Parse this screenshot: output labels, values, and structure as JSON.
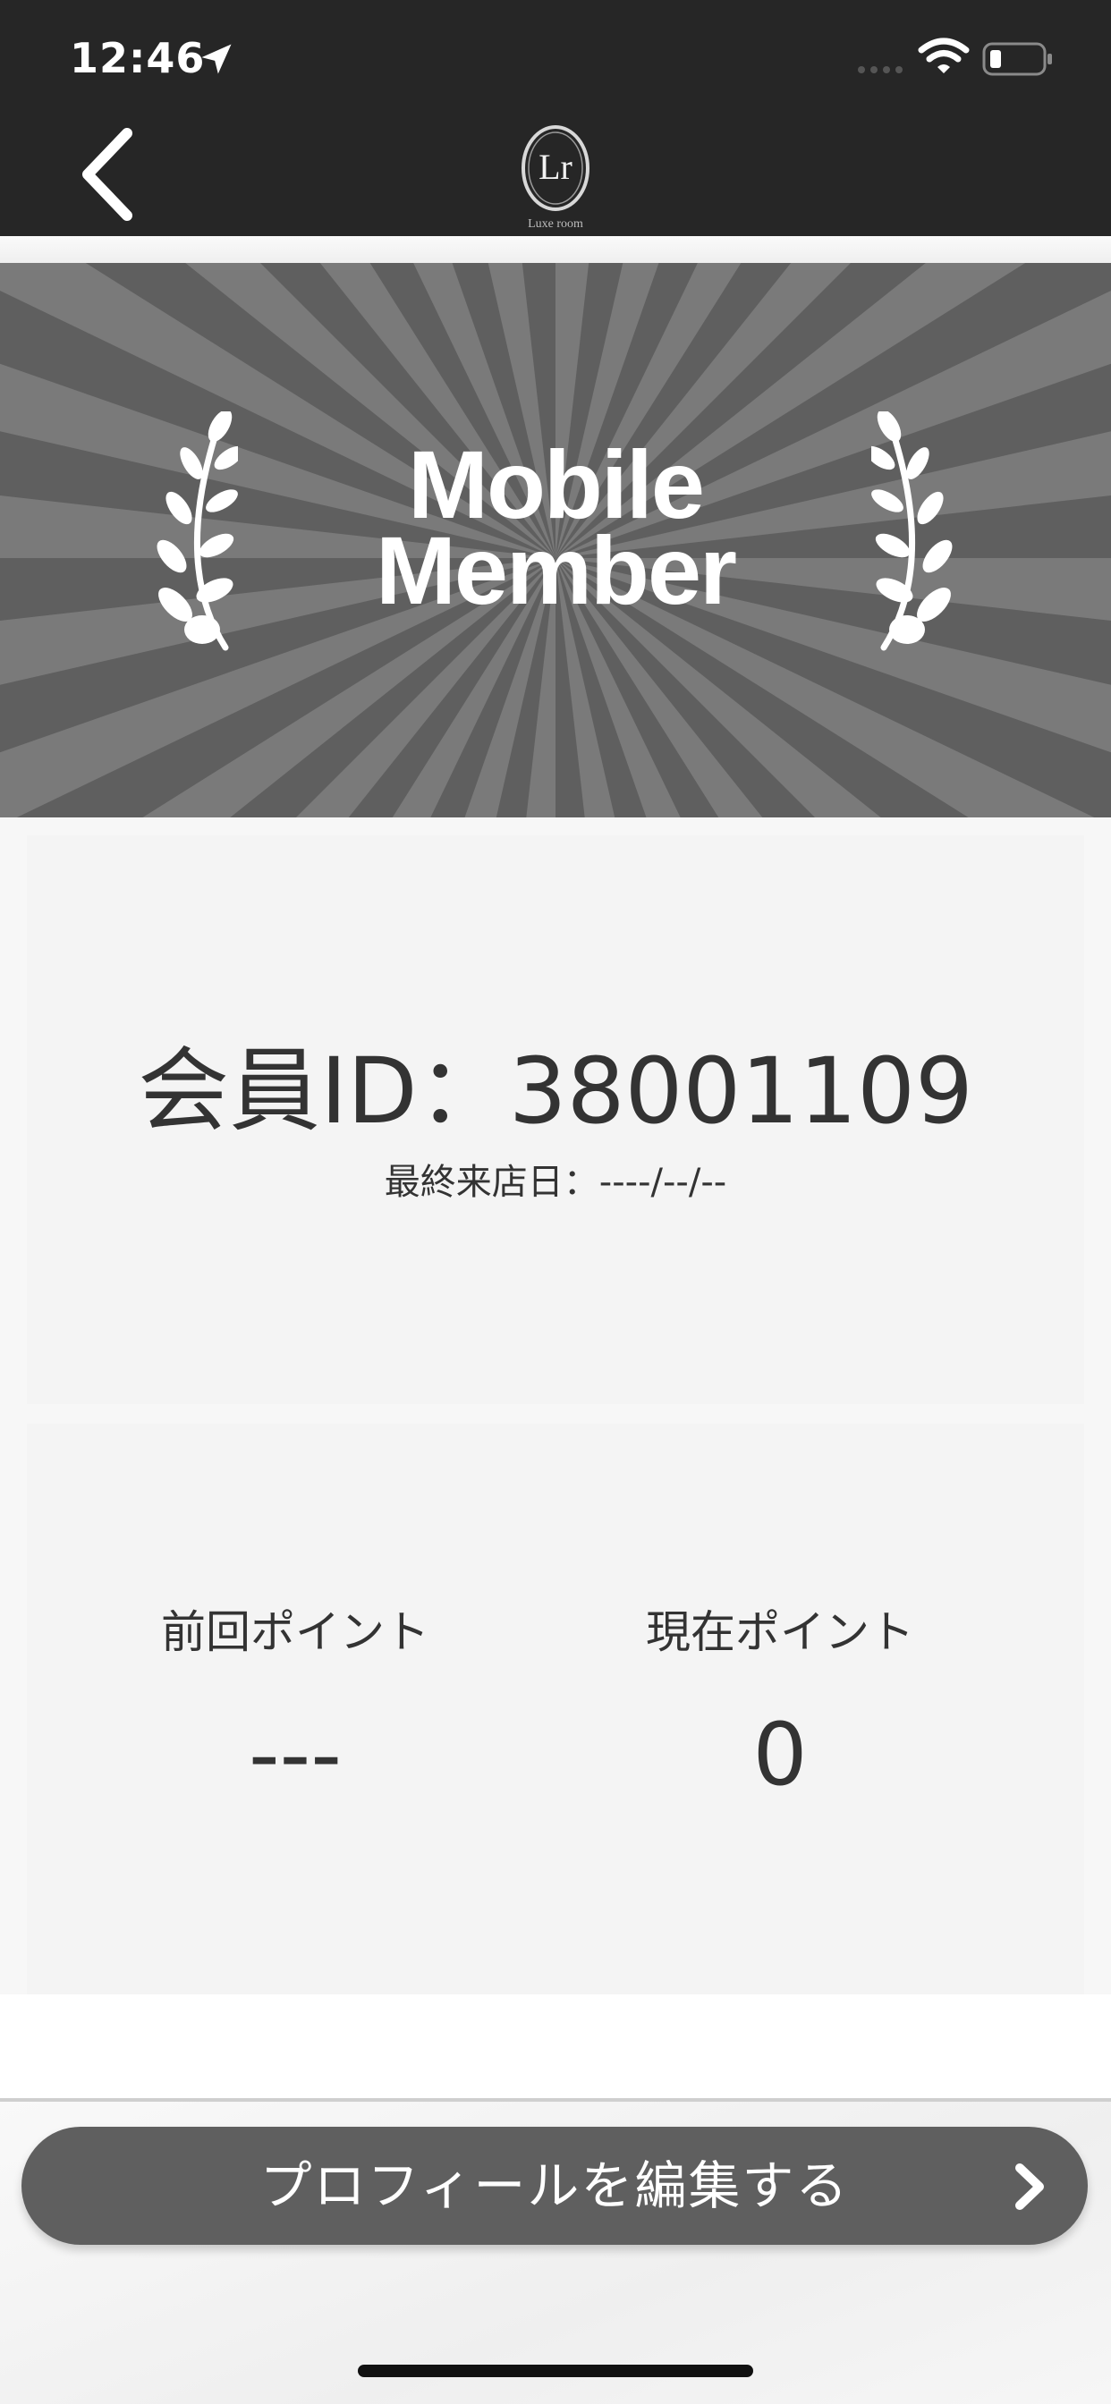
{
  "status_bar": {
    "time": "12:46",
    "icons": [
      "location-arrow-icon",
      "cellular-signal-icon",
      "wifi-icon",
      "battery-icon"
    ]
  },
  "header": {
    "back_icon": "chevron-left-icon",
    "logo_monogram": "Lr",
    "logo_text": "Luxe room"
  },
  "hero": {
    "title_line1": "Mobile",
    "title_line2": "Member",
    "decorations": [
      "laurel-left-icon",
      "laurel-right-icon"
    ]
  },
  "member": {
    "id_label": "会員ID：",
    "id_value": "38001109",
    "last_visit_label": "最終来店日：",
    "last_visit_value": "----/--/--"
  },
  "points": {
    "previous_label": "前回ポイント",
    "previous_value": "---",
    "current_label": "現在ポイント",
    "current_value": "0"
  },
  "footer": {
    "edit_button_label": "プロフィールを編集する",
    "edit_button_icon": "chevron-right-icon"
  },
  "colors": {
    "topbar": "#262626",
    "hero_dark": "#5f5f5f",
    "hero_light": "#7a7a7a",
    "card": "#f4f4f4",
    "button": "#5f5f5f",
    "text": "#333333"
  }
}
